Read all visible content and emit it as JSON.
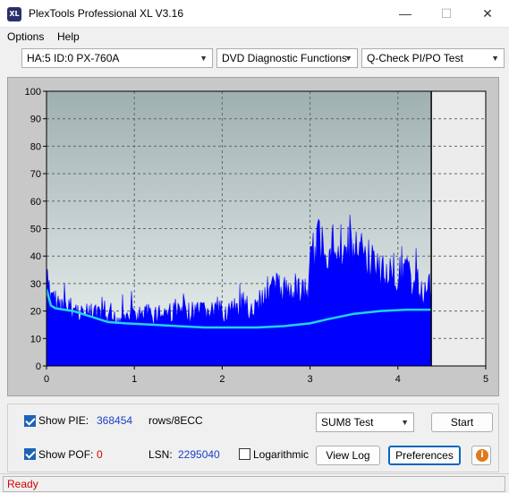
{
  "window": {
    "title": "PlexTools Professional XL V3.16",
    "icon_text": "XL",
    "controls": {
      "minimize": "—",
      "maximize": "☐",
      "close": "✕"
    }
  },
  "menu": [
    {
      "label": "Options",
      "underline": "O"
    },
    {
      "label": "Help",
      "underline": "H"
    }
  ],
  "toolbar": {
    "drive": "HA:5 ID:0  PX-760A",
    "function": "DVD Diagnostic Functions",
    "test": "Q-Check PI/PO Test"
  },
  "chart_data": {
    "type": "area",
    "x_ticks": [
      "0",
      "1",
      "2",
      "3",
      "4",
      "5"
    ],
    "y_ticks": [
      "0",
      "10",
      "20",
      "30",
      "40",
      "50",
      "60",
      "70",
      "80",
      "90",
      "100"
    ],
    "xlim": [
      0,
      5
    ],
    "ylim": [
      0,
      100
    ],
    "grid": true,
    "end_marker_x": 4.38,
    "colors": {
      "pie_fill": "#0000ff",
      "sum8_line": "#22d3e8",
      "plot_bg_top": "#9fb0b0",
      "plot_bg_bottom": "#f0f4f4",
      "after_end_bg": "#ececec"
    },
    "series": [
      {
        "kind": "pie_envelope",
        "points": [
          [
            0,
            39
          ],
          [
            0.04,
            30
          ],
          [
            0.1,
            28
          ],
          [
            0.2,
            26
          ],
          [
            0.3,
            25
          ],
          [
            0.4,
            24
          ],
          [
            0.5,
            23
          ],
          [
            0.6,
            22
          ],
          [
            0.7,
            20
          ],
          [
            0.8,
            21
          ],
          [
            0.9,
            22
          ],
          [
            1.0,
            22
          ],
          [
            1.2,
            23
          ],
          [
            1.4,
            24
          ],
          [
            1.6,
            23
          ],
          [
            1.8,
            24
          ],
          [
            2.0,
            24
          ],
          [
            2.2,
            25
          ],
          [
            2.4,
            26
          ],
          [
            2.5,
            33
          ],
          [
            2.6,
            35
          ],
          [
            2.7,
            33
          ],
          [
            2.8,
            35
          ],
          [
            2.9,
            33
          ],
          [
            2.97,
            31
          ],
          [
            3.0,
            45
          ],
          [
            3.1,
            55
          ],
          [
            3.2,
            53
          ],
          [
            3.3,
            55
          ],
          [
            3.4,
            52
          ],
          [
            3.5,
            50
          ],
          [
            3.6,
            49
          ],
          [
            3.7,
            46
          ],
          [
            3.8,
            42
          ],
          [
            3.9,
            43
          ],
          [
            4.0,
            40
          ],
          [
            4.1,
            40
          ],
          [
            4.2,
            36
          ],
          [
            4.3,
            33
          ],
          [
            4.38,
            34
          ]
        ]
      },
      {
        "kind": "sum8_line",
        "points": [
          [
            0,
            28
          ],
          [
            0.05,
            22
          ],
          [
            0.1,
            21
          ],
          [
            0.3,
            20
          ],
          [
            0.5,
            18
          ],
          [
            0.7,
            16
          ],
          [
            0.9,
            15.5
          ],
          [
            1.2,
            15
          ],
          [
            1.5,
            14.5
          ],
          [
            1.8,
            14
          ],
          [
            2.1,
            14
          ],
          [
            2.4,
            14
          ],
          [
            2.7,
            14.5
          ],
          [
            3.0,
            15.5
          ],
          [
            3.2,
            17
          ],
          [
            3.5,
            19
          ],
          [
            3.8,
            20
          ],
          [
            4.1,
            20.5
          ],
          [
            4.38,
            20.5
          ]
        ]
      }
    ]
  },
  "controls": {
    "show_pie_label": "Show PIE:",
    "show_pie_checked": true,
    "pie_value": "368454",
    "pie_unit": "rows/8ECC",
    "show_pof_label": "Show POF:",
    "show_pof_checked": true,
    "pof_value": "0",
    "lsn_label": "LSN:",
    "lsn_value": "2295040",
    "logarithmic_label": "Logarithmic",
    "logarithmic_checked": false,
    "test_select": "SUM8 Test",
    "start_button": "Start",
    "view_log_button": "View Log",
    "preferences_button": "Preferences",
    "info_icon": "i"
  },
  "status": {
    "text": "Ready",
    "color": "#d40000"
  }
}
